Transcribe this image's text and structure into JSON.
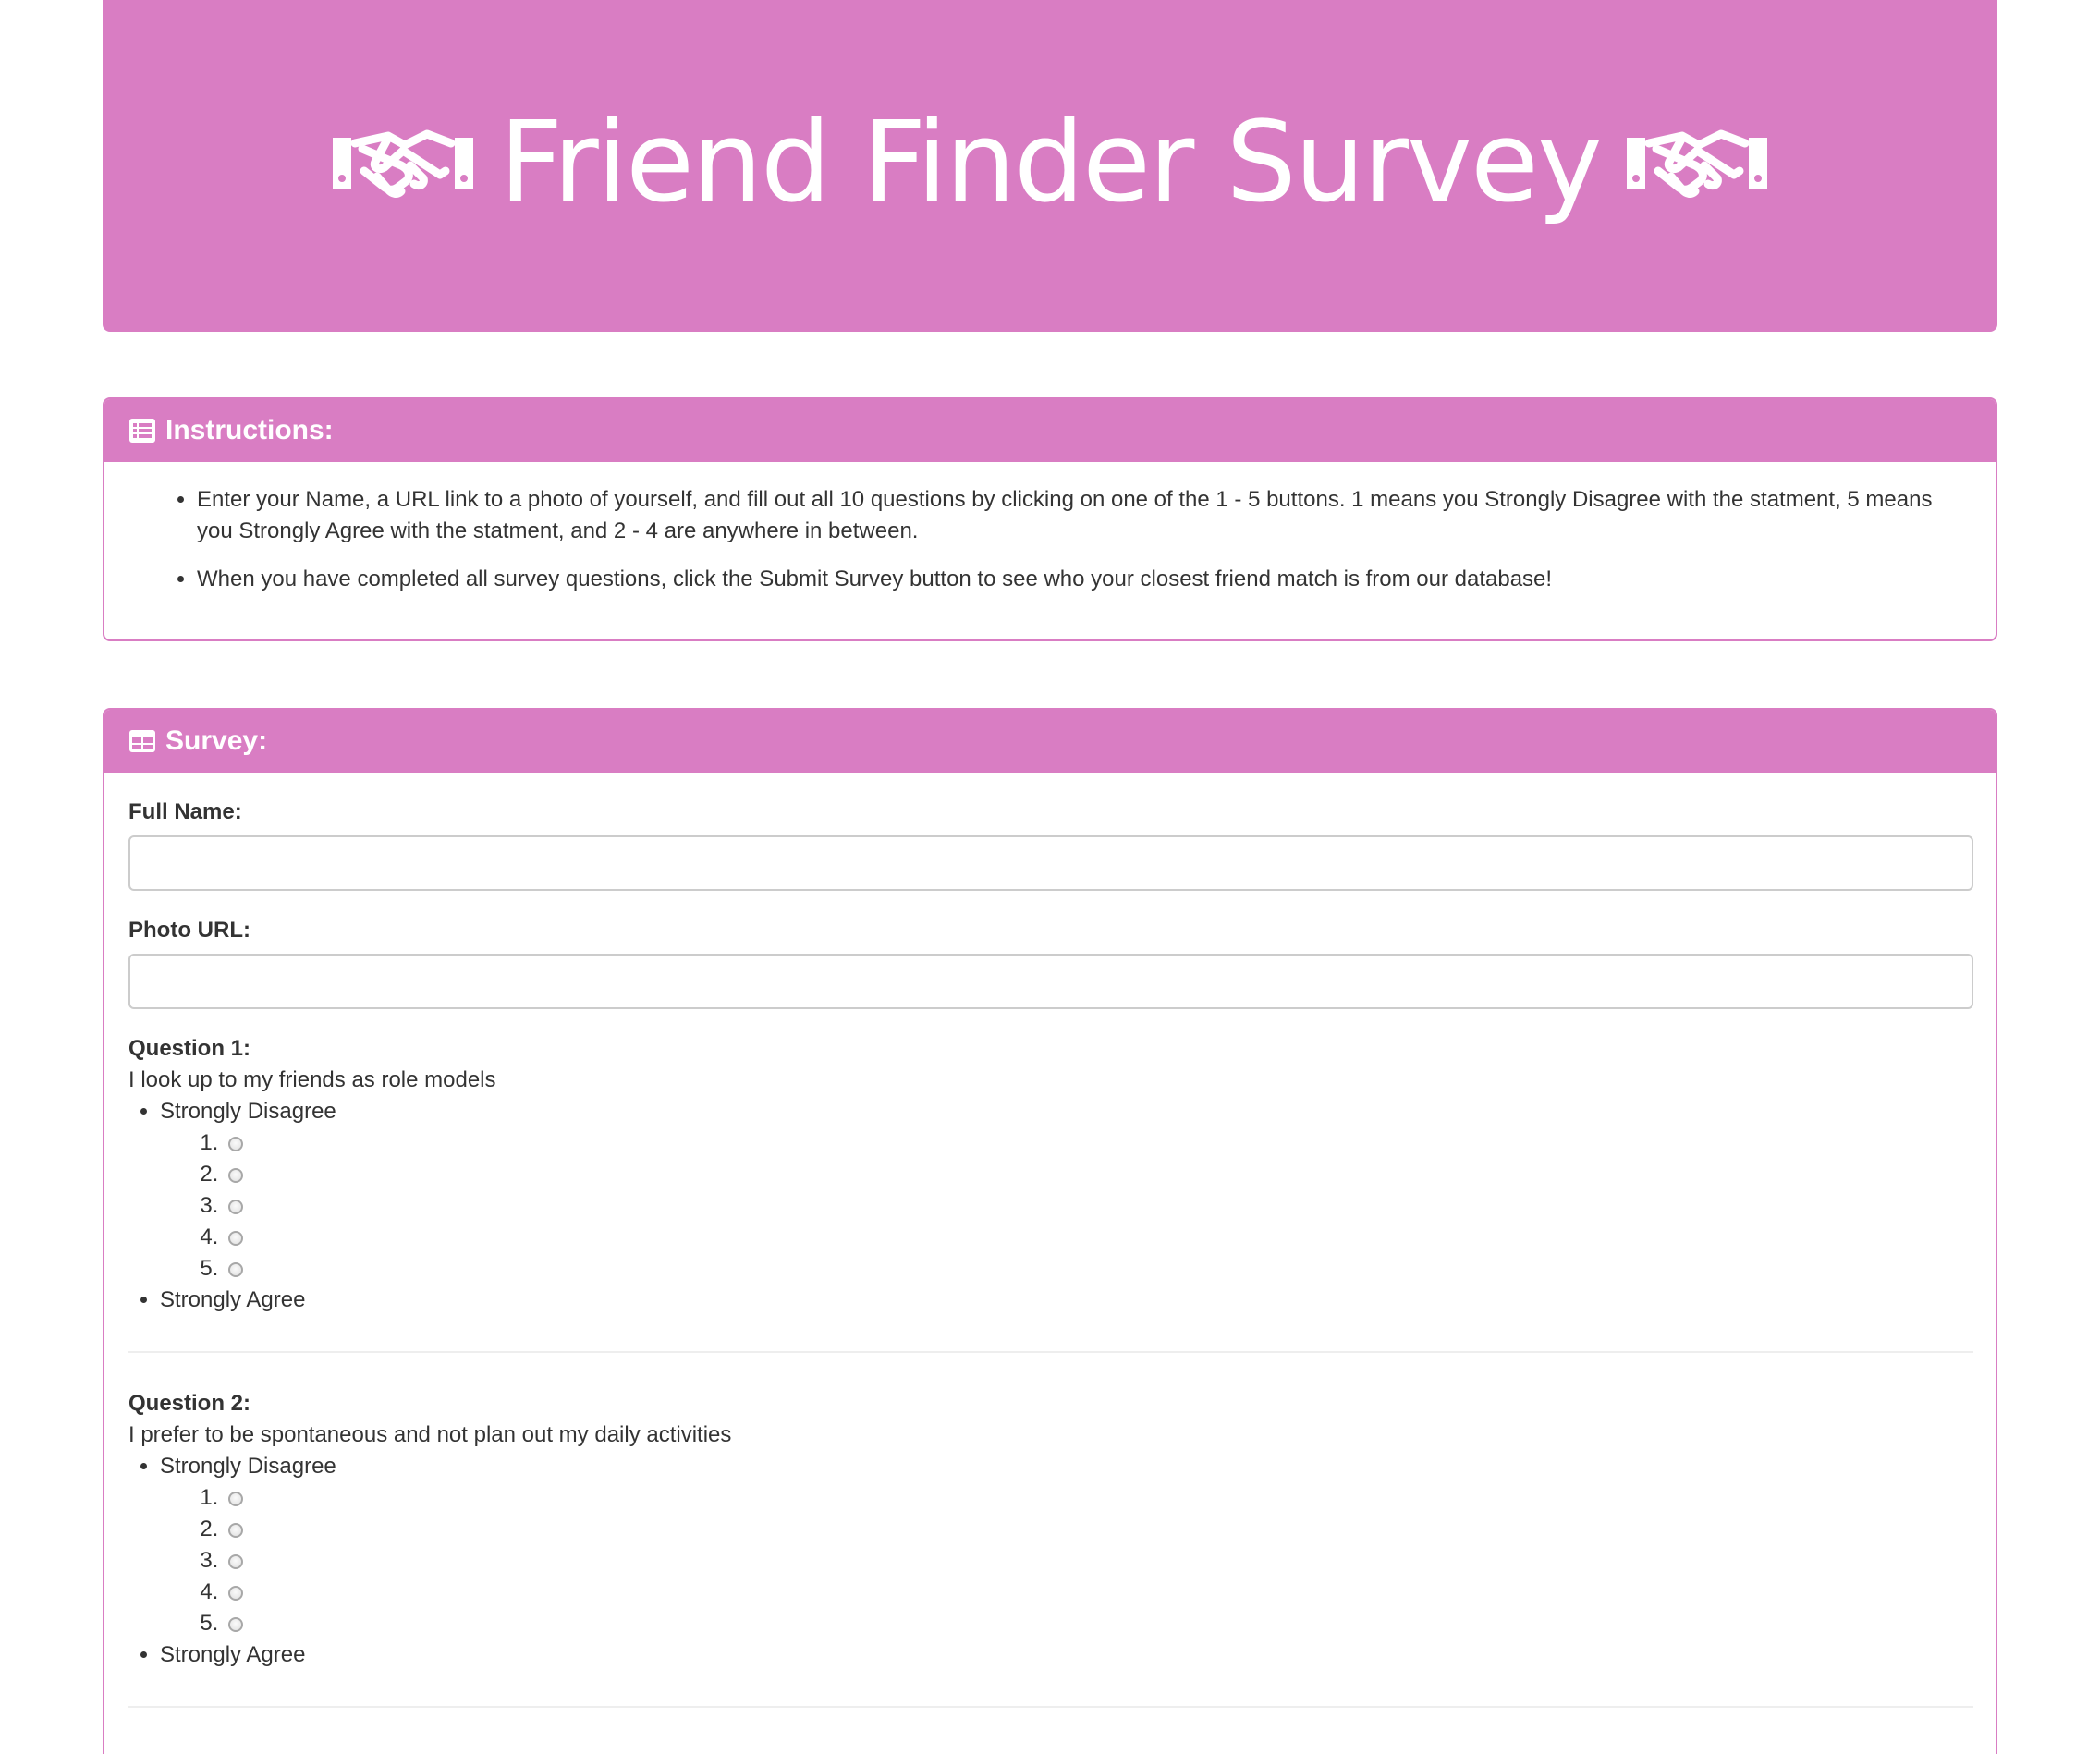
{
  "header": {
    "title": "Friend Finder Survey",
    "icon": "handshake-icon",
    "background_color": "#d97dc3"
  },
  "instructions": {
    "heading": "Instructions:",
    "heading_icon": "list-icon",
    "items": [
      "Enter your Name, a URL link to a photo of yourself, and fill out all 10 questions by clicking on one of the 1 - 5 buttons. 1 means you Strongly Disagree with the statment, 5 means you Strongly Agree with the statment, and 2 - 4 are anywhere in between.",
      "When you have completed all survey questions, click the Submit Survey button to see who your closest friend match is from our database!"
    ]
  },
  "survey": {
    "heading": "Survey:",
    "heading_icon": "table-icon",
    "name_label": "Full Name:",
    "name_value": "",
    "photo_label": "Photo URL:",
    "photo_value": "",
    "questions": [
      {
        "title": "Question 1:",
        "text": "I look up to my friends as role models",
        "low_label": "Strongly Disagree",
        "high_label": "Strongly Agree",
        "options": [
          "1",
          "2",
          "3",
          "4",
          "5"
        ]
      },
      {
        "title": "Question 2:",
        "text": "I prefer to be spontaneous and not plan out my daily activities",
        "low_label": "Strongly Disagree",
        "high_label": "Strongly Agree",
        "options": [
          "1",
          "2",
          "3",
          "4",
          "5"
        ]
      }
    ]
  }
}
